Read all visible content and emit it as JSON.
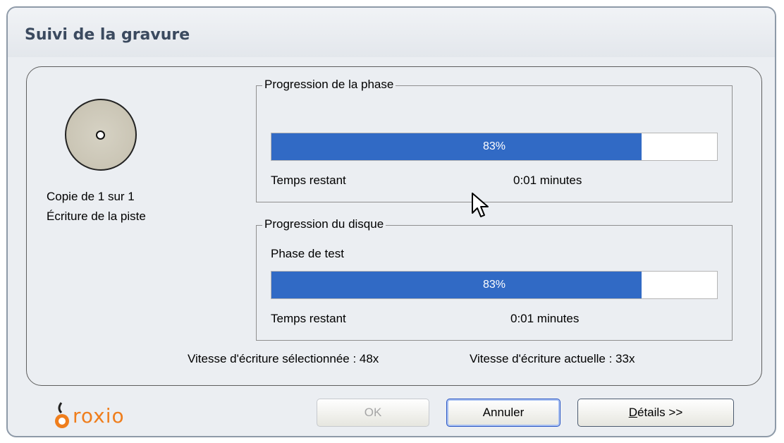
{
  "window": {
    "title": "Suivi de la gravure"
  },
  "status": {
    "copy_line": "Copie de 1 sur 1",
    "action_line": "Écriture de la piste",
    "disc_icon": "cd-disc-icon"
  },
  "phase_group": {
    "legend": "Progression de la phase",
    "progress": {
      "percent": 83,
      "text": "83%"
    },
    "time_label": "Temps restant",
    "time_value": "0:01 minutes"
  },
  "disc_group": {
    "legend": "Progression du disque",
    "phase_label": "Phase de test",
    "progress": {
      "percent": 83,
      "text": "83%"
    },
    "time_label": "Temps restant",
    "time_value": "0:01 minutes"
  },
  "speed": {
    "selected": "Vitesse d'écriture sélectionnée : 48x",
    "current": "Vitesse d'écriture actuelle : 33x"
  },
  "buttons": {
    "ok": "OK",
    "cancel": "Annuler",
    "details": "Détails >>"
  },
  "logo": {
    "text": "roxio",
    "icon": "roxio-logo-icon"
  },
  "colors": {
    "progress_fill": "#316ac5",
    "window_bg": "#ebeef2",
    "logo_orange": "#ef7e1d",
    "title_text": "#3b4a5f"
  }
}
